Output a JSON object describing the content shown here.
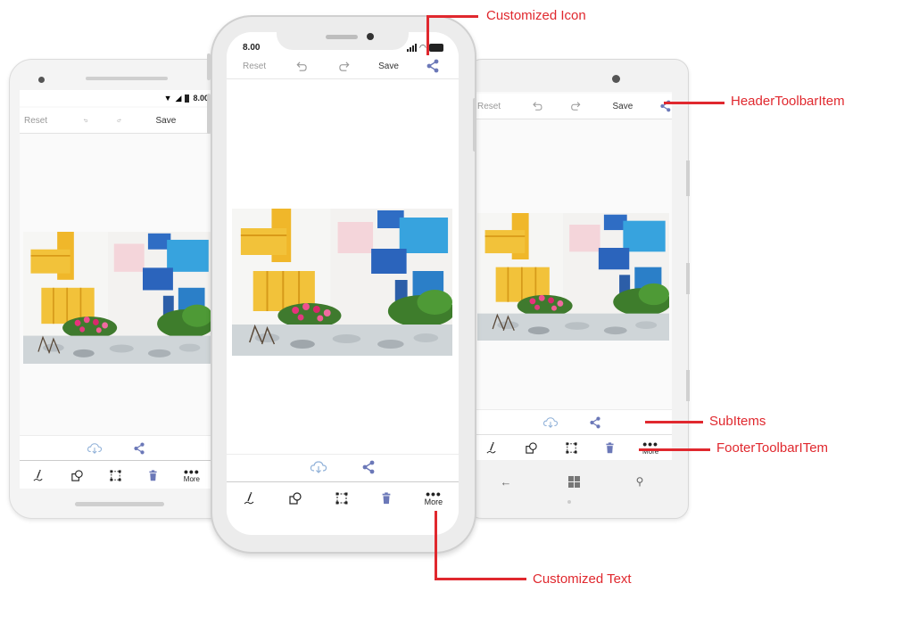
{
  "annotations": {
    "customized_icon": "Customized Icon",
    "header_toolbar_item": "HeaderToolbarItem",
    "sub_items": "SubItems",
    "footer_toolbar_item": "FooterToolbarITem",
    "customized_text": "Customized Text"
  },
  "toolbar": {
    "reset": "Reset",
    "save": "Save"
  },
  "footer": {
    "more": "More"
  },
  "status": {
    "android_time": "8.00",
    "iphone_time": "8.00"
  },
  "colors": {
    "annotation": "#e0282e",
    "accent_icon": "#6b78b8"
  },
  "icons": [
    "undo-icon",
    "redo-icon",
    "share-icon",
    "cloud-download-icon",
    "ink-pen-icon",
    "shapes-icon",
    "crop-icon",
    "delete-icon",
    "more-icon",
    "back-arrow-icon",
    "windows-logo-icon",
    "search-icon"
  ]
}
